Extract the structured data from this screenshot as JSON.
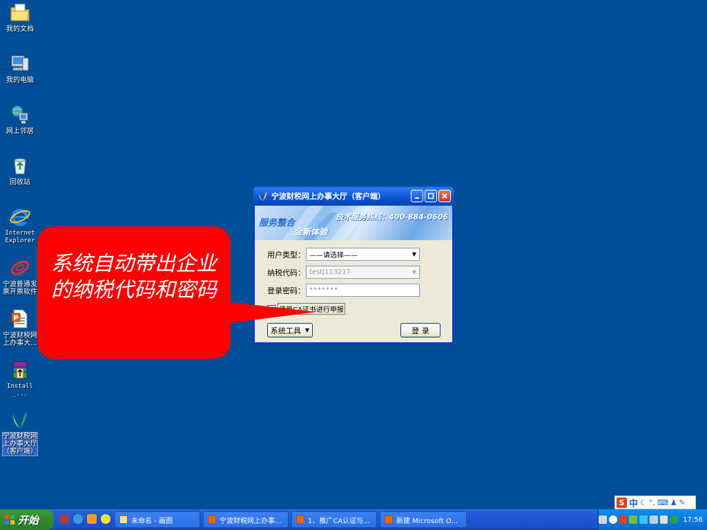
{
  "desktop": {
    "icons": [
      {
        "label": "我的文档",
        "icon": "folder-documents-icon"
      },
      {
        "label": "我的电脑",
        "icon": "computer-icon"
      },
      {
        "label": "网上邻居",
        "icon": "network-icon"
      },
      {
        "label": "回收站",
        "icon": "recycle-bin-icon"
      },
      {
        "label": "Internet\nExplorer",
        "icon": "ie-icon"
      },
      {
        "label": "宁波普通发\n票开票软件",
        "icon": "invoice-software-icon"
      },
      {
        "label": "宁波财税网\n上办事大...",
        "icon": "ppt-shortcut-icon"
      },
      {
        "label": "Install_...",
        "icon": "winrar-installer-icon"
      },
      {
        "label": "宁波财税网\n上办事大厅\n（客户端）",
        "icon": "ningbo-tax-client-icon"
      }
    ]
  },
  "window": {
    "title": "宁波财税网上办事大厅（客户端）",
    "banner": {
      "slogan1": "服务整合",
      "slogan2": "全新体验",
      "hotline": "技术服务热线：400-884-0606"
    },
    "fields": {
      "user_type_label": "用户类型：",
      "user_type_value": "——请选择——",
      "tax_code_label": "纳税代码：",
      "tax_code_value": "testj113217",
      "password_label": "登录密码：",
      "password_value": "*******"
    },
    "ca_checkbox_label": "使用CA证书进行申报",
    "ca_checked": true,
    "tools_button": "系统工具",
    "login_button": "登 录"
  },
  "callout": {
    "text": "系统自动带出企业的纳税代码和密码"
  },
  "ime": {
    "logo": "S",
    "mode": "中"
  },
  "taskbar": {
    "start_label": "开始",
    "tasks": [
      {
        "label": "未命名 - 画图"
      },
      {
        "label": "宁波财税网上办事..."
      },
      {
        "label": "1、推广CA认证与..."
      },
      {
        "label": "新建 Microsoft O..."
      }
    ],
    "clock": "17:56"
  },
  "colors": {
    "desktop": "#004e98",
    "callout": "#ff0000",
    "titlebar": "#0a54d0",
    "start": "#2f8b2f"
  }
}
